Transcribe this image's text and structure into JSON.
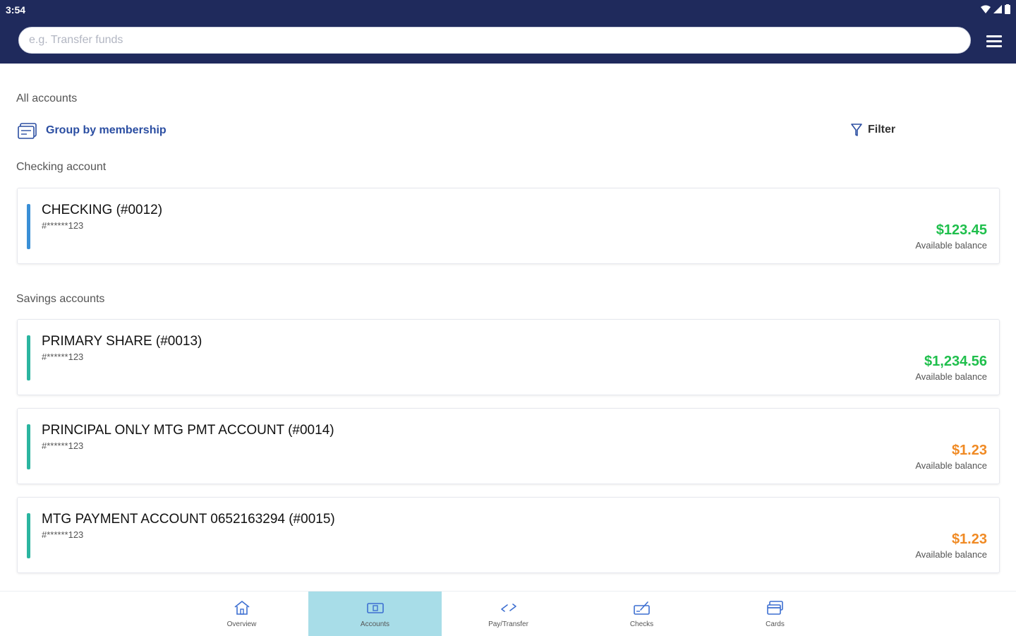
{
  "status": {
    "time": "3:54"
  },
  "search": {
    "placeholder": "e.g. Transfer funds"
  },
  "header": {
    "menu_icon": "hamburger-menu-icon"
  },
  "all_accounts_label": "All accounts",
  "group_by": {
    "label": "Group by membership",
    "icon": "group-by-membership-icon"
  },
  "filter": {
    "label": "Filter",
    "icon": "filter-funnel-icon"
  },
  "sections": {
    "checking": {
      "title": "Checking account"
    },
    "savings": {
      "title": "Savings accounts"
    }
  },
  "accounts": [
    {
      "name": "CHECKING (#0012)",
      "masked": "#******123",
      "amount": "$123.45",
      "balance_label": "Available balance",
      "amount_color": "#1fbf4c",
      "bar_color": "#3a8fd6"
    },
    {
      "name": "PRIMARY SHARE (#0013)",
      "masked": "#******123",
      "amount": "$1,234.56",
      "balance_label": "Available balance",
      "amount_color": "#1fbf4c",
      "bar_color": "#2bb5a0"
    },
    {
      "name": "PRINCIPAL ONLY MTG PMT ACCOUNT (#0014)",
      "masked": "#******123",
      "amount": "$1.23",
      "balance_label": "Available balance",
      "amount_color": "#f08a24",
      "bar_color": "#2bb5a0"
    },
    {
      "name": "MTG PAYMENT ACCOUNT 0652163294 (#0015)",
      "masked": "#******123",
      "amount": "$1.23",
      "balance_label": "Available balance",
      "amount_color": "#f08a24",
      "bar_color": "#2bb5a0"
    }
  ],
  "nav": [
    {
      "label": "Overview",
      "icon": "home-icon",
      "active": false
    },
    {
      "label": "Accounts",
      "icon": "accounts-icon",
      "active": true
    },
    {
      "label": "Pay/Transfer",
      "icon": "transfer-arrows-icon",
      "active": false
    },
    {
      "label": "Checks",
      "icon": "checks-icon",
      "active": false
    },
    {
      "label": "Cards",
      "icon": "cards-icon",
      "active": false
    }
  ],
  "colors": {
    "header_bg": "#1f2a5c",
    "link_blue": "#2b4ea2",
    "active_tab": "#a8dde8"
  }
}
